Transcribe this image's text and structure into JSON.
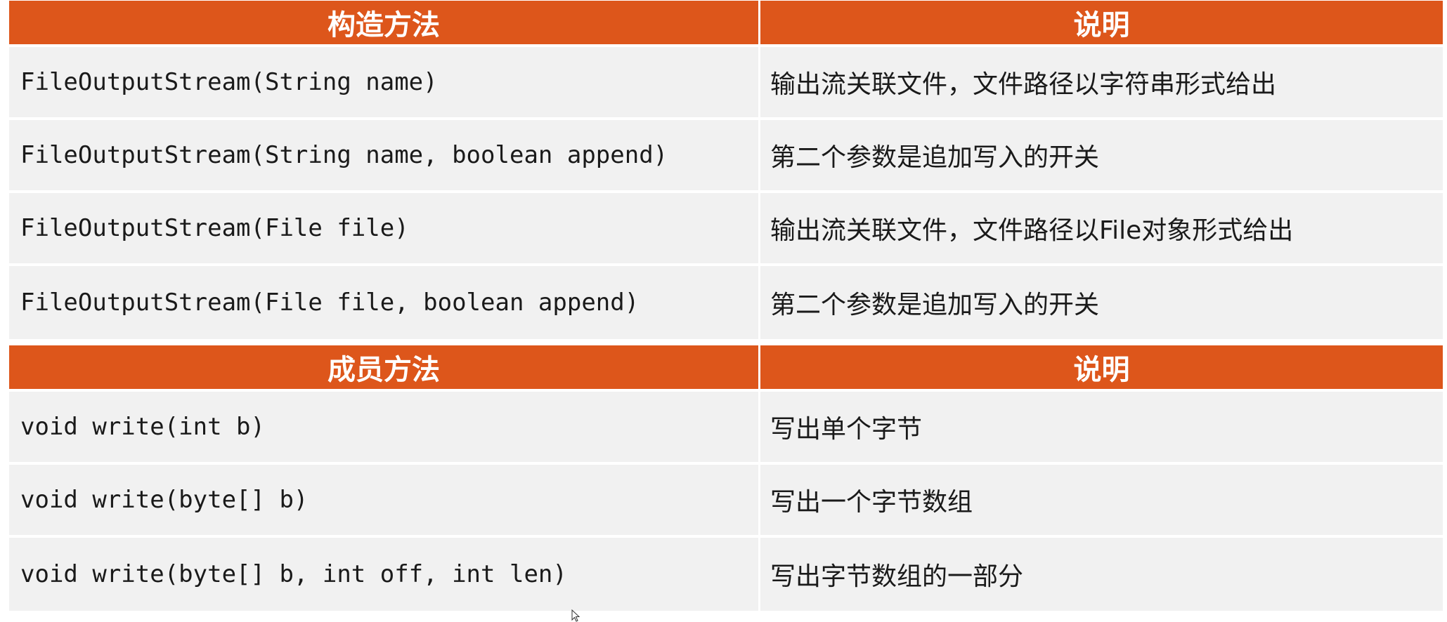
{
  "constructors": {
    "header_method": "构造方法",
    "header_desc": "说明",
    "rows": [
      {
        "method": "FileOutputStream(String name)",
        "desc": "输出流关联文件，文件路径以字符串形式给出"
      },
      {
        "method": "FileOutputStream(String name, boolean append)",
        "desc": "第二个参数是追加写入的开关"
      },
      {
        "method": "FileOutputStream(File file)",
        "desc": "输出流关联文件，文件路径以File对象形式给出"
      },
      {
        "method": "FileOutputStream(File file, boolean append)",
        "desc": "第二个参数是追加写入的开关"
      }
    ]
  },
  "members": {
    "header_method": "成员方法",
    "header_desc": "说明",
    "rows": [
      {
        "method": "void write(int b)",
        "desc": "写出单个字节"
      },
      {
        "method": "void write(byte[] b)",
        "desc": "写出一个字节数组"
      },
      {
        "method": "void write(byte[] b, int off, int len)",
        "desc": "写出字节数组的一部分"
      }
    ]
  },
  "colors": {
    "header_bg": "#dd561b",
    "row_bg": "#f1f1f1",
    "text": "#1a1a1a"
  },
  "icons": {
    "pointer": "mouse-pointer-icon"
  }
}
